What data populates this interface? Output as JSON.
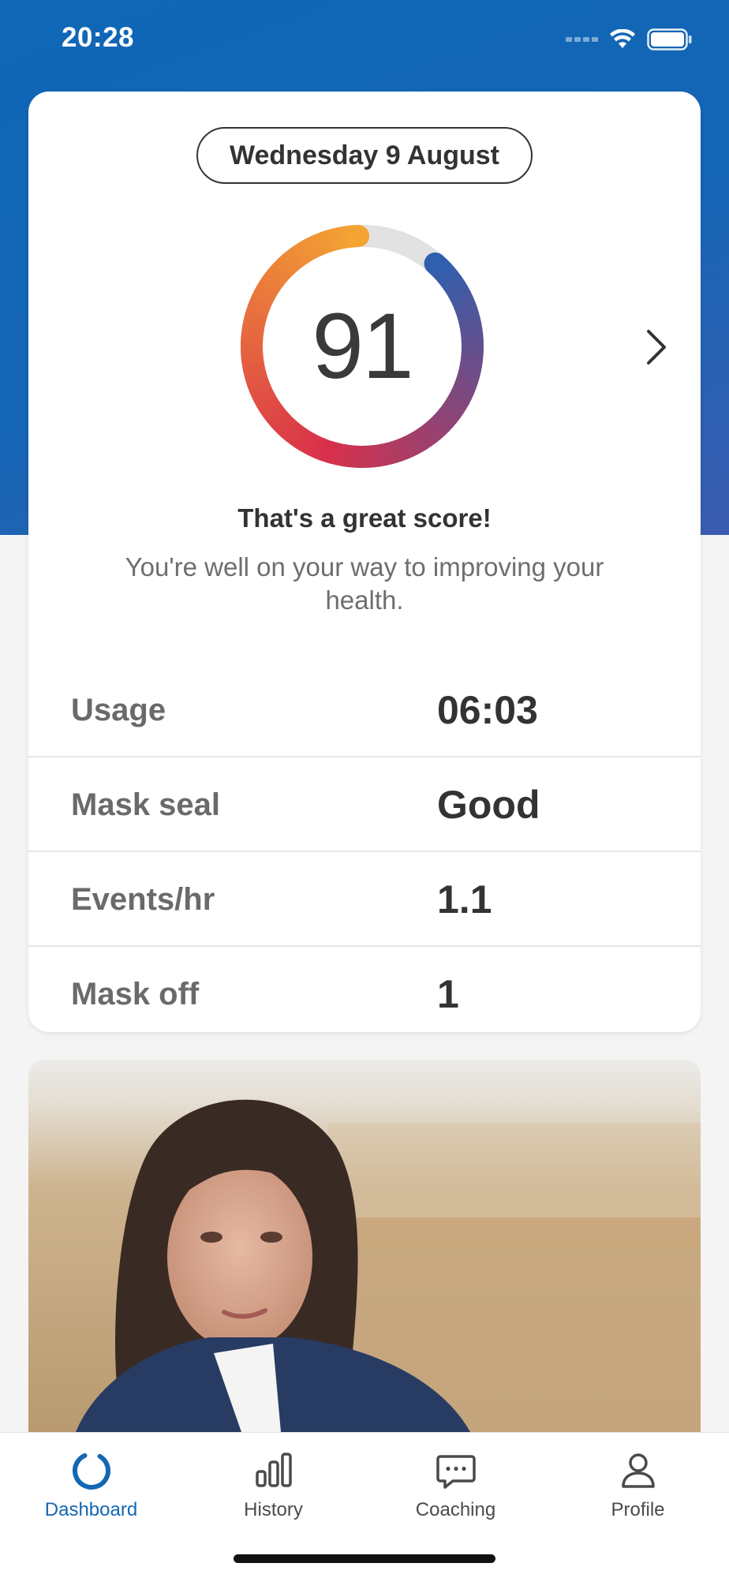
{
  "status_bar": {
    "time": "20:28"
  },
  "date_label": "Wednesday 9 August",
  "score": {
    "value": "91",
    "fraction": 0.91,
    "headline": "That's a great score!",
    "message": "You're well on your way to improving your health."
  },
  "metrics": [
    {
      "label": "Usage",
      "value": "06:03"
    },
    {
      "label": "Mask seal",
      "value": "Good"
    },
    {
      "label": "Events/hr",
      "value": "1.1"
    },
    {
      "label": "Mask off",
      "value": "1"
    }
  ],
  "tabs": [
    {
      "label": "Dashboard",
      "icon": "dashboard-ring-icon",
      "active": true
    },
    {
      "label": "History",
      "icon": "bar-chart-icon",
      "active": false
    },
    {
      "label": "Coaching",
      "icon": "chat-bubble-icon",
      "active": false
    },
    {
      "label": "Profile",
      "icon": "person-icon",
      "active": false
    }
  ],
  "colors": {
    "brand_blue": "#1467b3",
    "ring_start": "#2f5fae",
    "ring_mid": "#d9304a",
    "ring_end": "#f4a433",
    "ring_track": "#e2e2e2"
  }
}
